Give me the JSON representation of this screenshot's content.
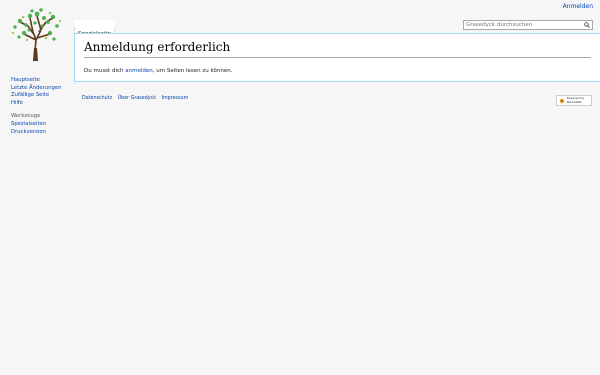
{
  "personal": {
    "login_label": "Anmelden"
  },
  "tabs": {
    "special_page": "Spezialseite"
  },
  "search": {
    "placeholder": "Grasedyck durchsuchen"
  },
  "page": {
    "title": "Anmeldung erforderlich",
    "text_before": "Du musst dich ",
    "link": "anmelden",
    "text_after": ", um Seiten lesen zu können."
  },
  "navigation": {
    "items": [
      "Hauptseite",
      "Letzte Änderungen",
      "Zufällige Seite",
      "Hilfe"
    ]
  },
  "tools": {
    "heading": "Werkzeuge",
    "items": [
      "Spezialseiten",
      "Druckversion"
    ]
  },
  "footer": {
    "links": [
      "Datenschutz",
      "Über Grasedyck",
      "Impressum"
    ],
    "powered_by": "Powered by MediaWiki"
  },
  "colors": {
    "link": "#0645ad",
    "background": "#f6f6f6",
    "border": "#a7d7f9"
  }
}
